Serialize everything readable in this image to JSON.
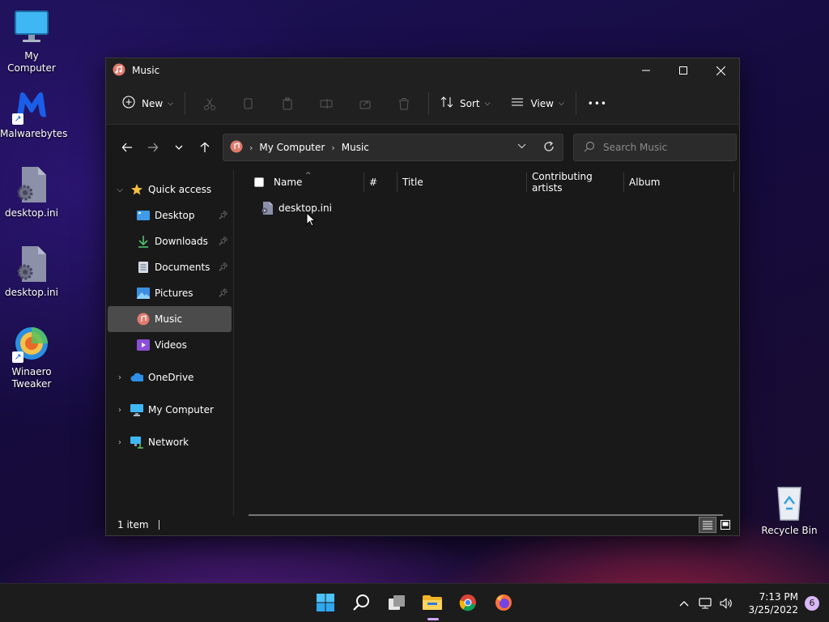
{
  "desktop": {
    "icons": [
      {
        "label": "My Computer"
      },
      {
        "label": "Malwarebytes"
      },
      {
        "label": "desktop.ini"
      },
      {
        "label": "desktop.ini"
      },
      {
        "label": "Winaero\nTweaker"
      },
      {
        "label": "Recycle Bin"
      }
    ]
  },
  "window": {
    "title": "Music",
    "toolbar": {
      "new_label": "New",
      "sort_label": "Sort",
      "view_label": "View",
      "more_label": "•••"
    },
    "address": {
      "crumbs": [
        "My Computer",
        "Music"
      ]
    },
    "search": {
      "placeholder": "Search Music"
    },
    "sidebar": {
      "quick_access": "Quick access",
      "items": [
        {
          "label": "Desktop"
        },
        {
          "label": "Downloads"
        },
        {
          "label": "Documents"
        },
        {
          "label": "Pictures"
        },
        {
          "label": "Music"
        },
        {
          "label": "Videos"
        }
      ],
      "onedrive": "OneDrive",
      "my_computer": "My Computer",
      "network": "Network"
    },
    "columns": [
      "Name",
      "#",
      "Title",
      "Contributing artists",
      "Album"
    ],
    "files": [
      {
        "name": "desktop.ini"
      }
    ],
    "status": "1 item"
  },
  "taskbar": {
    "time": "7:13 PM",
    "date": "3/25/2022",
    "notifications": "6"
  }
}
